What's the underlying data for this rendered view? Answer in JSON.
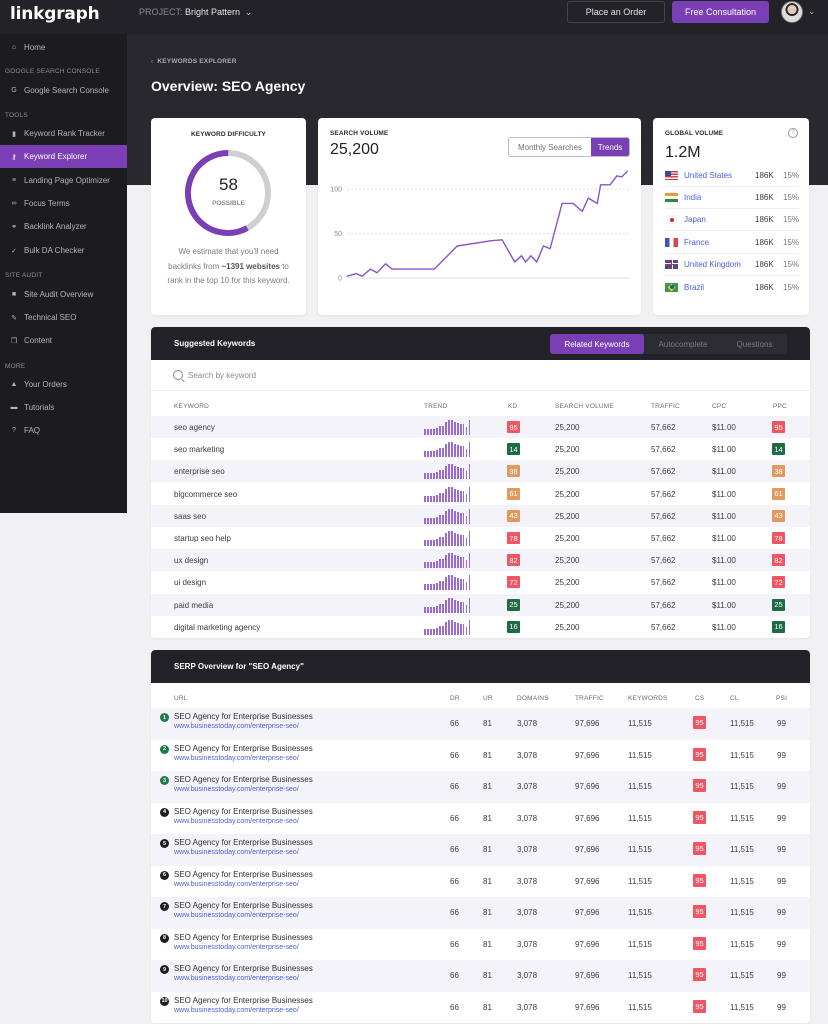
{
  "app": {
    "logo": "linkgraph",
    "project_label": "PROJECT:",
    "project_name": "Bright Pattern",
    "place_order": "Place an Order",
    "free_consultation": "Free Consultation",
    "accent": "#7b3fb5"
  },
  "sidebar": {
    "home": {
      "label": "Home",
      "icon": "home-icon"
    },
    "sections": [
      {
        "title": "GOOGLE SEARCH CONSOLE"
      },
      {
        "title": "TOOLS"
      },
      {
        "title": "SITE AUDIT"
      },
      {
        "title": "MORE"
      }
    ],
    "items": [
      {
        "label": "Google Search Console",
        "icon": "google-icon",
        "glyph": "G"
      },
      {
        "label": "Keyword Rank Tracker",
        "icon": "bar-chart-icon",
        "glyph": "▮"
      },
      {
        "label": "Keyword Explorer",
        "icon": "key-icon",
        "glyph": "⚷",
        "active": true
      },
      {
        "label": "Landing Page Optimizer",
        "icon": "list-icon",
        "glyph": "≡"
      },
      {
        "label": "Focus Terms",
        "icon": "link-icon",
        "glyph": "∞"
      },
      {
        "label": "Backlink Analyzer",
        "icon": "chain-icon",
        "glyph": "⚭"
      },
      {
        "label": "Bulk DA Checker",
        "icon": "check-icon",
        "glyph": "✓"
      },
      {
        "label": "Site Audit Overview",
        "icon": "square-icon",
        "glyph": "■"
      },
      {
        "label": "Technical SEO",
        "icon": "wrench-icon",
        "glyph": "✎"
      },
      {
        "label": "Content",
        "icon": "copy-icon",
        "glyph": "❐"
      },
      {
        "label": "Your Orders",
        "icon": "bag-icon",
        "glyph": "▲"
      },
      {
        "label": "Tutorials",
        "icon": "video-icon",
        "glyph": "▬"
      },
      {
        "label": "FAQ",
        "icon": "question-icon",
        "glyph": "?"
      }
    ]
  },
  "header": {
    "breadcrumb": "KEYWORDS EXPLORER",
    "title": "Overview: SEO Agency"
  },
  "keyword_difficulty": {
    "label": "KEYWORD DIFFICULTY",
    "value": "58",
    "percent": 58,
    "status": "POSSIBLE",
    "desc_pre": "We estimate that you'll need backlinks from ",
    "desc_bold": "~1391 websites",
    "desc_post": " to rank in the top 10 for this keyword."
  },
  "search_volume": {
    "label": "SEARCH VOLUME",
    "value": "25,200",
    "toggle": [
      "Monthly Searches",
      "Trends"
    ],
    "active_toggle": "Trends"
  },
  "chart_data": {
    "type": "line",
    "title": "Search Volume Trends",
    "xlabel": "",
    "ylabel": "",
    "ylim": [
      0,
      125
    ],
    "yticks": [
      0,
      50,
      100
    ],
    "grid": true,
    "series": [
      {
        "name": "Trends",
        "color": "#8a55c4",
        "values": [
          2,
          5,
          2,
          10,
          6,
          16,
          10,
          10,
          36,
          42,
          43,
          18,
          25,
          18,
          25,
          18,
          36,
          33,
          84,
          84,
          75,
          90,
          84,
          105,
          105,
          115,
          114,
          120
        ],
        "x": [
          0,
          3.3,
          5.4,
          8.4,
          10.8,
          13.8,
          16.2,
          31.3,
          39.5,
          51.8,
          55.6,
          60.1,
          62.5,
          64,
          65.9,
          68,
          70.4,
          72.8,
          77.1,
          81,
          84.3,
          86.5,
          89.7,
          90.9,
          94.3,
          96.7,
          98.5,
          100.5
        ]
      }
    ]
  },
  "global_volume": {
    "label": "GLOBAL VOLUME",
    "value": "1.2M",
    "countries": [
      {
        "name": "United States",
        "flag": "us",
        "volume": "186K",
        "pct": "15%"
      },
      {
        "name": "India",
        "flag": "in",
        "volume": "186K",
        "pct": "15%"
      },
      {
        "name": "Japan",
        "flag": "jp",
        "volume": "186K",
        "pct": "15%"
      },
      {
        "name": "France",
        "flag": "fr",
        "volume": "186K",
        "pct": "15%"
      },
      {
        "name": "United Kingdom",
        "flag": "gb",
        "volume": "186K",
        "pct": "15%"
      },
      {
        "name": "Brazil",
        "flag": "br",
        "volume": "186K",
        "pct": "15%"
      }
    ]
  },
  "suggested": {
    "title": "Suggested Keywords",
    "tabs": [
      "Related Keywords",
      "Autocomplete",
      "Questions"
    ],
    "active_tab": "Related Keywords",
    "search_placeholder": "Search by keyword",
    "columns": [
      "KEYWORD",
      "TREND",
      "KD",
      "SEARCH VOLUME",
      "TRAFFIC",
      "CPC",
      "PPC"
    ],
    "trend_shape": [
      0.4,
      0.4,
      0.4,
      0.4,
      0.45,
      0.6,
      0.6,
      0.85,
      1.0,
      1.0,
      0.85,
      0.8,
      0.75,
      0.7,
      0.55,
      1.0
    ],
    "badge_colors": {
      "red": "#f05563",
      "green": "#1e6b45",
      "orange": "#e0995e"
    },
    "rows": [
      {
        "keyword": "seo agency",
        "kd": "95",
        "color": "red",
        "volume": "25,200",
        "traffic": "57,662",
        "cpc": "$11.00",
        "ppc": "95"
      },
      {
        "keyword": "seo marketing",
        "kd": "14",
        "color": "green",
        "volume": "25,200",
        "traffic": "57,662",
        "cpc": "$11.00",
        "ppc": "14"
      },
      {
        "keyword": "enterprise seo",
        "kd": "38",
        "color": "orange",
        "volume": "25,200",
        "traffic": "57,662",
        "cpc": "$11.00",
        "ppc": "38"
      },
      {
        "keyword": "bigcommerce seo",
        "kd": "61",
        "color": "orange",
        "volume": "25,200",
        "traffic": "57,662",
        "cpc": "$11.00",
        "ppc": "61"
      },
      {
        "keyword": "saas seo",
        "kd": "43",
        "color": "orange",
        "volume": "25,200",
        "traffic": "57,662",
        "cpc": "$11.00",
        "ppc": "43"
      },
      {
        "keyword": "startup seo help",
        "kd": "78",
        "color": "red",
        "volume": "25,200",
        "traffic": "57,662",
        "cpc": "$11.00",
        "ppc": "78"
      },
      {
        "keyword": "ux design",
        "kd": "82",
        "color": "red",
        "volume": "25,200",
        "traffic": "57,662",
        "cpc": "$11.00",
        "ppc": "82"
      },
      {
        "keyword": "ui design",
        "kd": "72",
        "color": "red",
        "volume": "25,200",
        "traffic": "57,662",
        "cpc": "$11.00",
        "ppc": "72"
      },
      {
        "keyword": "paid media",
        "kd": "25",
        "color": "green",
        "volume": "25,200",
        "traffic": "57,662",
        "cpc": "$11.00",
        "ppc": "25"
      },
      {
        "keyword": "digital marketing agency",
        "kd": "16",
        "color": "green",
        "volume": "25,200",
        "traffic": "57,662",
        "cpc": "$11.00",
        "ppc": "16"
      }
    ]
  },
  "serp": {
    "title": "SERP Overview for \"SEO Agency\"",
    "columns": [
      "URL",
      "DR",
      "UR",
      "DOMAINS",
      "TRAFFIC",
      "KEYWORDS",
      "CS",
      "CL",
      "PSI"
    ],
    "rows": [
      {
        "pos": "1",
        "title": "SEO Agency for Enterprise Businesses",
        "url": "www.businesstoday.com/enterprise-seo/",
        "dr": "66",
        "ur": "81",
        "domains": "3,078",
        "traffic": "97,696",
        "keywords": "11,515",
        "cs": "95",
        "cl": "11,515",
        "psi": "99"
      },
      {
        "pos": "2",
        "title": "SEO Agency for Enterprise Businesses",
        "url": "www.businesstoday.com/enterprise-seo/",
        "dr": "66",
        "ur": "81",
        "domains": "3,078",
        "traffic": "97,696",
        "keywords": "11,515",
        "cs": "95",
        "cl": "11,515",
        "psi": "99"
      },
      {
        "pos": "3",
        "title": "SEO Agency for Enterprise Businesses",
        "url": "www.businesstoday.com/enterprise-seo/",
        "dr": "66",
        "ur": "81",
        "domains": "3,078",
        "traffic": "97,696",
        "keywords": "11,515",
        "cs": "95",
        "cl": "11,515",
        "psi": "99"
      },
      {
        "pos": "4",
        "title": "SEO Agency for Enterprise Businesses",
        "url": "www.businesstoday.com/enterprise-seo/",
        "dr": "66",
        "ur": "81",
        "domains": "3,078",
        "traffic": "97,696",
        "keywords": "11,515",
        "cs": "95",
        "cl": "11,515",
        "psi": "99"
      },
      {
        "pos": "5",
        "title": "SEO Agency for Enterprise Businesses",
        "url": "www.businesstoday.com/enterprise-seo/",
        "dr": "66",
        "ur": "81",
        "domains": "3,078",
        "traffic": "97,696",
        "keywords": "11,515",
        "cs": "95",
        "cl": "11,515",
        "psi": "99"
      },
      {
        "pos": "6",
        "title": "SEO Agency for Enterprise Businesses",
        "url": "www.businesstoday.com/enterprise-seo/",
        "dr": "66",
        "ur": "81",
        "domains": "3,078",
        "traffic": "97,696",
        "keywords": "11,515",
        "cs": "95",
        "cl": "11,515",
        "psi": "99"
      },
      {
        "pos": "7",
        "title": "SEO Agency for Enterprise Businesses",
        "url": "www.businesstoday.com/enterprise-seo/",
        "dr": "66",
        "ur": "81",
        "domains": "3,078",
        "traffic": "97,696",
        "keywords": "11,515",
        "cs": "95",
        "cl": "11,515",
        "psi": "99"
      },
      {
        "pos": "8",
        "title": "SEO Agency for Enterprise Businesses",
        "url": "www.businesstoday.com/enterprise-seo/",
        "dr": "66",
        "ur": "81",
        "domains": "3,078",
        "traffic": "97,696",
        "keywords": "11,515",
        "cs": "95",
        "cl": "11,515",
        "psi": "99"
      },
      {
        "pos": "9",
        "title": "SEO Agency for Enterprise Businesses",
        "url": "www.businesstoday.com/enterprise-seo/",
        "dr": "66",
        "ur": "81",
        "domains": "3,078",
        "traffic": "97,696",
        "keywords": "11,515",
        "cs": "95",
        "cl": "11,515",
        "psi": "99"
      },
      {
        "pos": "10",
        "title": "SEO Agency for Enterprise Businesses",
        "url": "www.businesstoday.com/enterprise-seo/",
        "dr": "66",
        "ur": "81",
        "domains": "3,078",
        "traffic": "97,696",
        "keywords": "11,515",
        "cs": "95",
        "cl": "11,515",
        "psi": "99"
      }
    ]
  }
}
